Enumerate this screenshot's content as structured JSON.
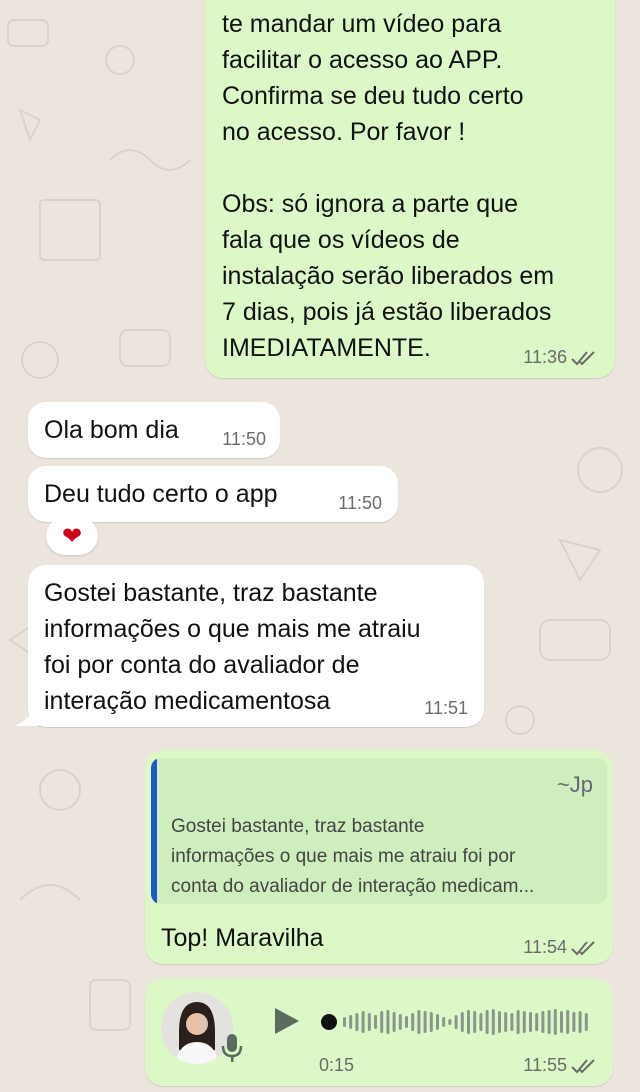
{
  "messages": {
    "out1": {
      "text": "te mandar um vídeo para\nfacilitar o acesso ao APP.\nConfirma se deu tudo certo\nno acesso. Por favor !\n\nObs: só ignora a parte que\nfala que os vídeos de\ninstalação serão liberados em\n7 dias, pois já estão liberados\nIMEDIATAMENTE.",
      "time": "11:36"
    },
    "in1": {
      "text": "Ola bom dia",
      "time": "11:50"
    },
    "in2": {
      "text": "Deu tudo certo o app",
      "time": "11:50",
      "reaction": "❤"
    },
    "in3": {
      "text": "Gostei bastante, traz bastante\ninformações o que mais me atraiu\nfoi por conta do avaliador de\ninteração medicamentosa",
      "time": "11:51"
    },
    "out2": {
      "quote_author": "~Jp",
      "quote_text": "Gostei bastante, traz bastante\ninformações o que mais me atraiu foi por\nconta do avaliador de interação medicam...",
      "text": "Top! Maravilha",
      "time": "11:54"
    },
    "voice": {
      "duration": "0:15",
      "time": "11:55"
    }
  },
  "colors": {
    "outgoing_bubble": "#dcf8c6",
    "incoming_bubble": "#ffffff",
    "read_ticks": "#6b6b6b",
    "quote_bar": "#1f58c6"
  },
  "icons": [
    "double-check-icon",
    "heart-icon",
    "play-icon",
    "microphone-icon",
    "avatar"
  ]
}
